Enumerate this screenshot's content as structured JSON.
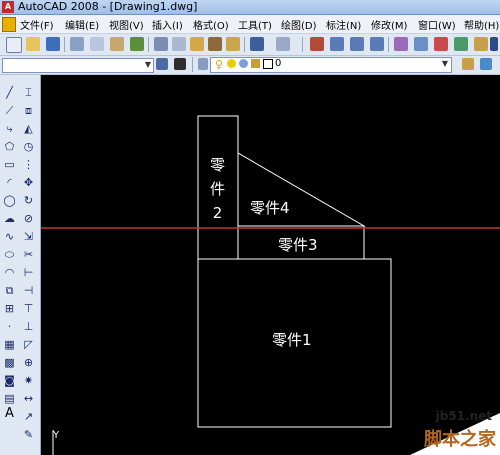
{
  "window": {
    "title": "AutoCAD 2008 - [Drawing1.dwg]",
    "app_icon": "A"
  },
  "menu": {
    "items": [
      "文件(F)",
      "编辑(E)",
      "视图(V)",
      "插入(I)",
      "格式(O)",
      "工具(T)",
      "绘图(D)",
      "标注(N)",
      "修改(M)",
      "窗口(W)",
      "帮助(H)"
    ]
  },
  "layers": {
    "current": "0"
  },
  "drawing": {
    "parts": [
      {
        "id": "part1",
        "label": "零件1"
      },
      {
        "id": "part2",
        "label": "零\n件\n2"
      },
      {
        "id": "part3",
        "label": "零件3"
      },
      {
        "id": "part4",
        "label": "零件4"
      }
    ],
    "crosshair_color": "#c0392b",
    "axis_label": "Y"
  },
  "left_toolbar": {
    "text_tool": "A"
  },
  "watermark": {
    "url": "jb51.net",
    "name": "脚本之家"
  }
}
